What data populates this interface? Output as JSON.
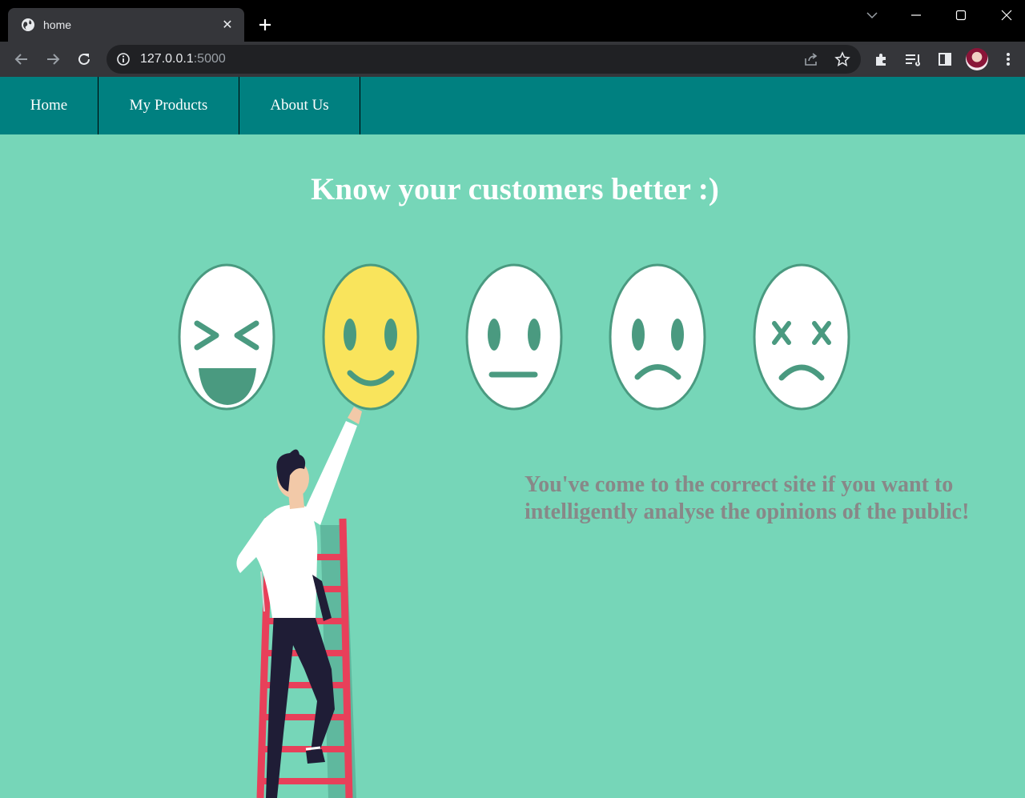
{
  "browser": {
    "tab_title": "home",
    "url_host": "127.0.0.1",
    "url_port": ":5000"
  },
  "nav": {
    "home": "Home",
    "products": "My Products",
    "about": "About Us"
  },
  "hero": {
    "title": "Know your customers better :)",
    "tagline": "You've come to the correct site if you want to intelligently analyse the opinions of the public!"
  },
  "illustration": {
    "faces": [
      "laughing-face",
      "smiling-face",
      "neutral-face",
      "sad-face",
      "dizzy-face"
    ],
    "figure": "man-on-ladder"
  },
  "colors": {
    "navbar": "#008080",
    "background": "#76d6b8",
    "face_outline": "#4a9a80",
    "face_happy": "#f9e45c",
    "tagline": "#888888"
  }
}
